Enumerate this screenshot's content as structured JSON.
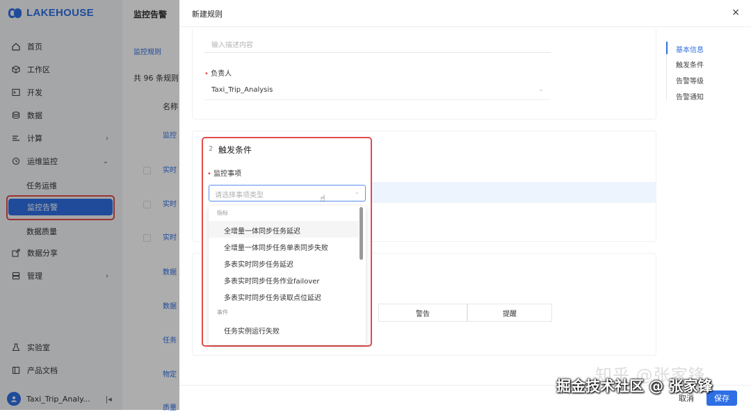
{
  "brand": {
    "name": "LAKEHOUSE",
    "color": "#2f6fe4"
  },
  "sidebar": {
    "items": [
      {
        "label": "首页",
        "icon": "home-icon"
      },
      {
        "label": "工作区",
        "icon": "cube-icon"
      },
      {
        "label": "开发",
        "icon": "terminal-icon"
      },
      {
        "label": "数据",
        "icon": "database-icon"
      },
      {
        "label": "计算",
        "icon": "compute-icon",
        "arrow": "›"
      },
      {
        "label": "运维监控",
        "icon": "monitor-icon",
        "arrow": "⌄"
      },
      {
        "label": "数据分享",
        "icon": "share-icon"
      },
      {
        "label": "管理",
        "icon": "manage-icon",
        "arrow": "›"
      },
      {
        "label": "实验室",
        "icon": "flask-icon"
      },
      {
        "label": "产品文档",
        "icon": "book-icon"
      }
    ],
    "sub_items": [
      "任务运维",
      "监控告警",
      "数据质量"
    ],
    "user": {
      "name": "Taxi_Trip_Analy...",
      "collapse": "|◂"
    }
  },
  "list_panel": {
    "title": "监控告警",
    "tab": "监控规则",
    "count": "共 96 条规则",
    "column_header": "名称",
    "rows": [
      "监控",
      "实时",
      "实时",
      "实时",
      "数据",
      "数据",
      "任务",
      "物定",
      "质量"
    ]
  },
  "drawer": {
    "title": "新建规则",
    "close": "×",
    "description_placeholder": "输入描述内容",
    "owner_label": "负责人",
    "owner_value": "Taxi_Trip_Analysis",
    "anchors": [
      "基本信息",
      "触发条件",
      "告警等级",
      "告警通知"
    ],
    "levels": [
      "警告",
      "提醒"
    ],
    "cancel": "取消",
    "save": "保存"
  },
  "trigger": {
    "number": "2",
    "title": "触发条件",
    "field_label": "监控事项",
    "placeholder": "请选择事项类型",
    "groups": [
      {
        "name": "指标",
        "options": [
          "全增量一体同步任务延迟",
          "全增量一体同步任务单表同步失败",
          "多表实时同步任务延迟",
          "多表实时同步任务作业failover",
          "多表实时同步任务读取点位延迟"
        ]
      },
      {
        "name": "事件",
        "options": [
          "任务实例运行失败"
        ]
      }
    ]
  },
  "watermark": {
    "line1": "知乎 @张家锋",
    "line2": "掘金技术社区 @ 张家锋"
  }
}
